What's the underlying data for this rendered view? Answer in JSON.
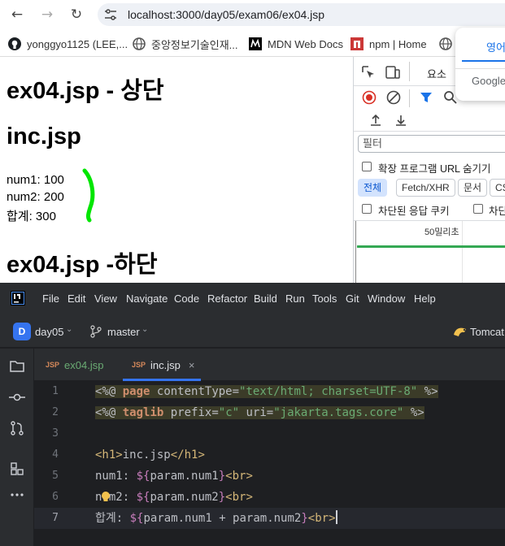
{
  "browser": {
    "url": "localhost:3000/day05/exam06/ex04.jsp",
    "bookmarks": [
      {
        "label": "yonggyo1125 (LEE,..."
      },
      {
        "label": "중앙정보기술인재..."
      },
      {
        "label": "MDN Web Docs"
      },
      {
        "label": "npm | Home"
      }
    ],
    "translate": {
      "lang": "영어",
      "provider": "Google"
    }
  },
  "page": {
    "top_heading": "ex04.jsp - 상단",
    "inc_heading": "inc.jsp",
    "lines": [
      "num1: 100",
      "num2: 200",
      "합계: 300"
    ],
    "bottom_heading": "ex04.jsp -하단"
  },
  "devtools": {
    "elements_tab": "요소",
    "filter_placeholder": "필터",
    "hide_extension_urls": "확장 프로그램 URL 숨기기",
    "filter_chips": [
      "전체",
      "Fetch/XHR",
      "문서",
      "CS"
    ],
    "blocked_cookies": "차단된 응답 쿠키",
    "blocked_requests": "차단",
    "timeline_label": "50밀리초"
  },
  "ide": {
    "menu": [
      "File",
      "Edit",
      "View",
      "Navigate",
      "Code",
      "Refactor",
      "Build",
      "Run",
      "Tools",
      "Git",
      "Window",
      "Help"
    ],
    "project": {
      "letter": "D",
      "name": "day05"
    },
    "branch": "master",
    "run_config": "Tomcat",
    "tabs": [
      {
        "label": "ex04.jsp",
        "badge": "JSP",
        "active": false
      },
      {
        "label": "inc.jsp",
        "badge": "JSP",
        "active": true
      }
    ],
    "code_lines": [
      {
        "num": "1"
      },
      {
        "num": "2"
      },
      {
        "num": "3"
      },
      {
        "num": "4"
      },
      {
        "num": "5"
      },
      {
        "num": "6"
      },
      {
        "num": "7"
      }
    ],
    "code": {
      "l1": {
        "open": "<%@",
        "kw": "page",
        "attr": "contentType=",
        "val": "\"text/html; charset=UTF-8\"",
        "close": "%>"
      },
      "l2": {
        "open": "<%@",
        "kw": "taglib",
        "attr1": "prefix=",
        "val1": "\"c\"",
        "attr2": "uri=",
        "val2": "\"jakarta.tags.core\"",
        "close": "%>"
      },
      "l4": {
        "open": "<h1>",
        "text": "inc.jsp",
        "close": "</h1>"
      },
      "l5": {
        "label": "num1: ",
        "el_open": "${",
        "expr": "param.num1",
        "el_close": "}",
        "br": "<br>"
      },
      "l6": {
        "label": "num2: ",
        "el_open": "${",
        "expr": "param.num2",
        "el_close": "}",
        "br": "<br>"
      },
      "l7": {
        "label": "합계: ",
        "el_open": "${",
        "expr": "param.num1 + param.num2",
        "el_close": "}",
        "br": "<br>"
      }
    }
  },
  "colors": {
    "annotation": "#00e600",
    "ide_bg": "#1e1f22",
    "devtools_accent": "#1a73e8"
  }
}
